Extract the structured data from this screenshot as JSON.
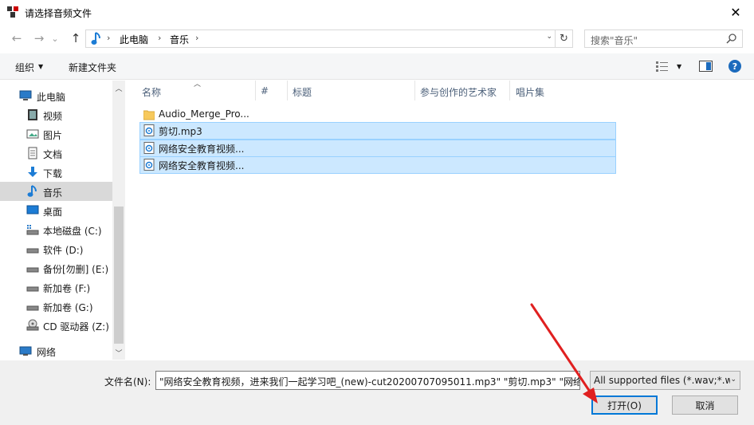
{
  "window": {
    "title": "请选择音频文件",
    "close_glyph": "✕"
  },
  "nav": {
    "back_glyph": "←",
    "forward_glyph": "→",
    "recent_glyph": "⌄",
    "up_glyph": "↑",
    "breadcrumb": [
      "此电脑",
      "音乐"
    ],
    "crumb_separator": "›",
    "dropdown_glyph": "⌄",
    "refresh_glyph": "↻",
    "search_placeholder": "搜索\"音乐\""
  },
  "toolbar": {
    "organize_label": "组织",
    "new_folder_label": "新建文件夹",
    "help_label": "?"
  },
  "sidebar": {
    "items": [
      {
        "label": "此电脑",
        "icon": "computer-icon"
      },
      {
        "label": "视频",
        "icon": "video-folder-icon"
      },
      {
        "label": "图片",
        "icon": "picture-folder-icon"
      },
      {
        "label": "文档",
        "icon": "document-folder-icon"
      },
      {
        "label": "下载",
        "icon": "download-icon"
      },
      {
        "label": "音乐",
        "icon": "music-icon",
        "selected": true
      },
      {
        "label": "桌面",
        "icon": "desktop-icon"
      },
      {
        "label": "本地磁盘 (C:)",
        "icon": "system-drive-icon"
      },
      {
        "label": "软件 (D:)",
        "icon": "drive-icon"
      },
      {
        "label": "备份[勿删] (E:)",
        "icon": "drive-icon"
      },
      {
        "label": "新加卷 (F:)",
        "icon": "drive-icon"
      },
      {
        "label": "新加卷 (G:)",
        "icon": "drive-icon"
      },
      {
        "label": "CD 驱动器 (Z:)",
        "icon": "cd-drive-icon"
      },
      {
        "label": "网络",
        "icon": "network-icon"
      }
    ]
  },
  "columns": [
    "名称",
    "#",
    "标题",
    "参与创作的艺术家",
    "唱片集"
  ],
  "files": [
    {
      "name": "Audio_Merge_Pro...",
      "type": "folder",
      "selected": false
    },
    {
      "name": "剪切.mp3",
      "type": "audio",
      "selected": true
    },
    {
      "name": "网络安全教育视频...",
      "type": "audio",
      "selected": true
    },
    {
      "name": "网络安全教育视频...",
      "type": "audio",
      "selected": true
    }
  ],
  "footer": {
    "filename_label": "文件名(N):",
    "filename_value": "\"网络安全教育视频，进来我们一起学习吧_(new)-cut20200707095011.mp3\" \"剪切.mp3\" \"网络",
    "filter_value": "All supported files (*.wav;*.w",
    "open_label": "打开(O)",
    "cancel_label": "取消"
  },
  "colors": {
    "selection": "#cce8ff",
    "selection_border": "#99d1ff",
    "primary_border": "#0078d7",
    "annotation_arrow": "#e02020"
  }
}
